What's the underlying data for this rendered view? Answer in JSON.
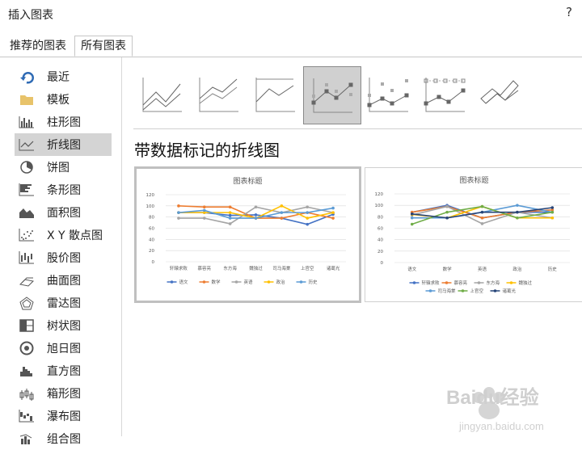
{
  "dialog": {
    "title": "插入图表",
    "help": "?"
  },
  "tabs": [
    {
      "label": "推荐的图表"
    },
    {
      "label": "所有图表"
    }
  ],
  "sidebar": {
    "items": [
      {
        "label": "最近",
        "icon": "recent-icon"
      },
      {
        "label": "模板",
        "icon": "folder-icon"
      },
      {
        "label": "柱形图",
        "icon": "column-chart-icon"
      },
      {
        "label": "折线图",
        "icon": "line-chart-icon",
        "selected": true
      },
      {
        "label": "饼图",
        "icon": "pie-chart-icon"
      },
      {
        "label": "条形图",
        "icon": "bar-chart-icon"
      },
      {
        "label": "面积图",
        "icon": "area-chart-icon"
      },
      {
        "label": "X Y 散点图",
        "icon": "scatter-chart-icon"
      },
      {
        "label": "股价图",
        "icon": "stock-chart-icon"
      },
      {
        "label": "曲面图",
        "icon": "surface-chart-icon"
      },
      {
        "label": "雷达图",
        "icon": "radar-chart-icon"
      },
      {
        "label": "树状图",
        "icon": "treemap-chart-icon"
      },
      {
        "label": "旭日图",
        "icon": "sunburst-chart-icon"
      },
      {
        "label": "直方图",
        "icon": "histogram-chart-icon"
      },
      {
        "label": "箱形图",
        "icon": "box-whisker-chart-icon"
      },
      {
        "label": "瀑布图",
        "icon": "waterfall-chart-icon"
      },
      {
        "label": "组合图",
        "icon": "combo-chart-icon"
      }
    ]
  },
  "subtypes": [
    {
      "icon": "line-icon"
    },
    {
      "icon": "stacked-line-icon"
    },
    {
      "icon": "percent-stacked-line-icon"
    },
    {
      "icon": "line-with-markers-icon",
      "selected": true
    },
    {
      "icon": "stacked-line-with-markers-icon"
    },
    {
      "icon": "percent-stacked-line-with-markers-icon"
    },
    {
      "icon": "3d-line-icon"
    }
  ],
  "heading": "带数据标记的折线图",
  "colors": {
    "blue": "#5b9bd5",
    "orange": "#ed7d31",
    "gray": "#a5a5a5",
    "yellow": "#ffc000",
    "lightblue": "#4472c4",
    "green": "#70ad47",
    "navy": "#264478"
  },
  "watermark": {
    "brand": "Baidu经验",
    "url": "jingyan.baidu.com"
  },
  "chart_data": [
    {
      "type": "line",
      "title": "图表标题",
      "categories": [
        "轩辕求败",
        "慕容亮",
        "东方海",
        "魏独过",
        "司马海棠",
        "上官空",
        "诸葛光"
      ],
      "ylim": [
        0,
        120
      ],
      "yticks": [
        0,
        20,
        40,
        60,
        80,
        100,
        120
      ],
      "grid": true,
      "legend_position": "bottom",
      "series": [
        {
          "name": "语文",
          "color": "#4472c4",
          "values": [
            88,
            88,
            83,
            84,
            78,
            67,
            85
          ]
        },
        {
          "name": "数学",
          "color": "#ed7d31",
          "values": [
            100,
            98,
            98,
            78,
            78,
            88,
            78
          ]
        },
        {
          "name": "英语",
          "color": "#a5a5a5",
          "values": [
            78,
            78,
            68,
            98,
            88,
            98,
            88
          ]
        },
        {
          "name": "政治",
          "color": "#ffc000",
          "values": [
            88,
            88,
            88,
            78,
            100,
            78,
            88
          ]
        },
        {
          "name": "历史",
          "color": "#5b9bd5",
          "values": [
            88,
            92,
            78,
            78,
            88,
            88,
            96
          ]
        }
      ]
    },
    {
      "type": "line",
      "title": "图表标题",
      "categories": [
        "语文",
        "数学",
        "英语",
        "政治",
        "历史"
      ],
      "ylim": [
        0,
        120
      ],
      "yticks": [
        0,
        20,
        40,
        60,
        80,
        100,
        120
      ],
      "grid": true,
      "legend_position": "bottom",
      "series": [
        {
          "name": "轩辕求败",
          "color": "#4472c4",
          "values": [
            88,
            100,
            78,
            88,
            88
          ]
        },
        {
          "name": "慕容亮",
          "color": "#ed7d31",
          "values": [
            88,
            98,
            78,
            88,
            92
          ]
        },
        {
          "name": "东方海",
          "color": "#a5a5a5",
          "values": [
            83,
            98,
            68,
            88,
            78
          ]
        },
        {
          "name": "魏独过",
          "color": "#ffc000",
          "values": [
            84,
            78,
            98,
            78,
            78
          ]
        },
        {
          "name": "司马海棠",
          "color": "#5b9bd5",
          "values": [
            78,
            78,
            88,
            100,
            88
          ]
        },
        {
          "name": "上官空",
          "color": "#70ad47",
          "values": [
            67,
            88,
            98,
            78,
            88
          ]
        },
        {
          "name": "诸葛光",
          "color": "#264478",
          "values": [
            85,
            78,
            88,
            88,
            96
          ]
        }
      ]
    }
  ]
}
